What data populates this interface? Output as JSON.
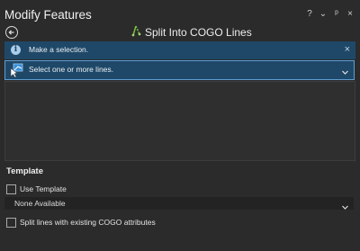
{
  "pane": {
    "title": "Modify Features"
  },
  "title_bar": {
    "help_glyph": "?",
    "menu_glyph": "⌄",
    "pin_glyph": "ᵖ",
    "close_glyph": "×"
  },
  "tool": {
    "title": "Split Into COGO Lines",
    "icon": "cogo-split-icon",
    "back_icon": "back-arrow-icon"
  },
  "message": {
    "icon": "info-icon",
    "icon_glyph": "i",
    "text": "Make a selection.",
    "close_glyph": "×"
  },
  "selection": {
    "icon": "select-lines-icon",
    "text": "Select one or more lines."
  },
  "template": {
    "heading": "Template",
    "use_template_label": "Use Template",
    "use_template_checked": false,
    "dropdown_value": "None Available"
  },
  "split_option": {
    "label": "Split lines with existing COGO attributes",
    "checked": false
  },
  "colors": {
    "accent": "#1f4868",
    "selection_border": "#5e9fd3",
    "tool_icon": "#7bc142"
  }
}
